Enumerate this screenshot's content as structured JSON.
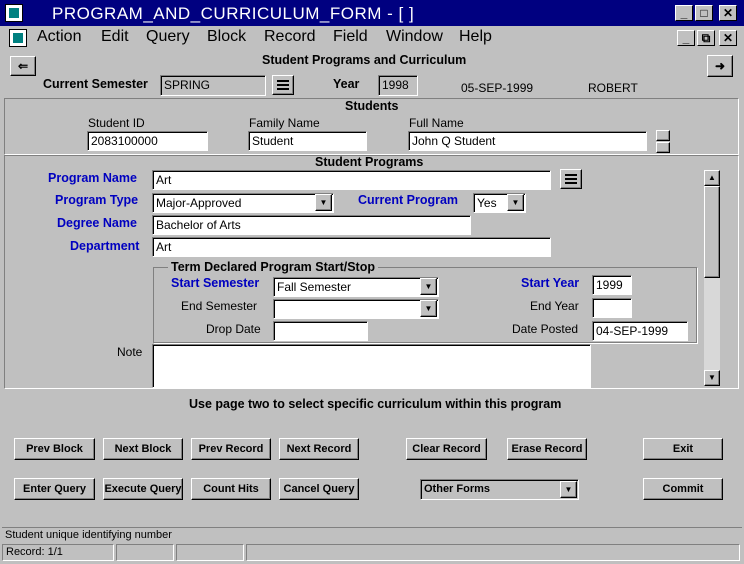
{
  "window": {
    "title": "PROGRAM_AND_CURRICULUM_FORM - [ ]",
    "min": "_",
    "max": "□",
    "close": "✕"
  },
  "menu": {
    "items": [
      "Action",
      "Edit",
      "Query",
      "Block",
      "Record",
      "Field",
      "Window",
      "Help"
    ],
    "restore_min": "_",
    "restore": "⧉",
    "restore_close": "✕"
  },
  "toolbar": {
    "heading": "Student Programs and Curriculum",
    "prev_arrow": "⇐",
    "next_arrow": "➜"
  },
  "semester": {
    "label": "Current Semester",
    "value": "SPRING",
    "year_label": "Year",
    "year_value": "1998",
    "date": "05-SEP-1999",
    "user": "ROBERT"
  },
  "students": {
    "heading": "Students",
    "id_label": "Student ID",
    "id_value": "2083100000",
    "family_label": "Family Name",
    "family_value": "Student",
    "full_label": "Full Name",
    "full_value": "John Q Student"
  },
  "programs": {
    "heading": "Student Programs",
    "program_name_label": "Program Name",
    "program_name": "Art",
    "program_type_label": "Program Type",
    "program_type": "Major-Approved",
    "current_program_label": "Current Program",
    "current_program": "Yes",
    "degree_label": "Degree Name",
    "degree": "Bachelor of Arts",
    "department_label": "Department",
    "department": "Art",
    "term_heading": "Term Declared Program  Start/Stop",
    "start_semester_label": "Start Semester",
    "start_semester": "Fall Semester",
    "start_year_label": "Start Year",
    "start_year": "1999",
    "end_semester_label": "End Semester",
    "end_semester": "",
    "end_year_label": "End Year",
    "end_year": "",
    "drop_date_label": "Drop Date",
    "drop_date": "",
    "date_posted_label": "Date Posted",
    "date_posted": "04-SEP-1999",
    "note_label": "Note",
    "note": ""
  },
  "hint": "Use page two to select specific curriculum within this program",
  "buttons": {
    "prev_block": "Prev Block",
    "next_block": "Next Block",
    "prev_record": "Prev Record",
    "next_record": "Next Record",
    "clear_record": "Clear Record",
    "erase_record": "Erase Record",
    "exit": "Exit",
    "enter_query": "Enter Query",
    "execute_query": "Execute Query",
    "count_hits": "Count Hits",
    "cancel_query": "Cancel Query",
    "other_forms": "Other Forms",
    "commit": "Commit"
  },
  "status": {
    "message": "Student unique identifying number",
    "record": "Record: 1/1"
  }
}
